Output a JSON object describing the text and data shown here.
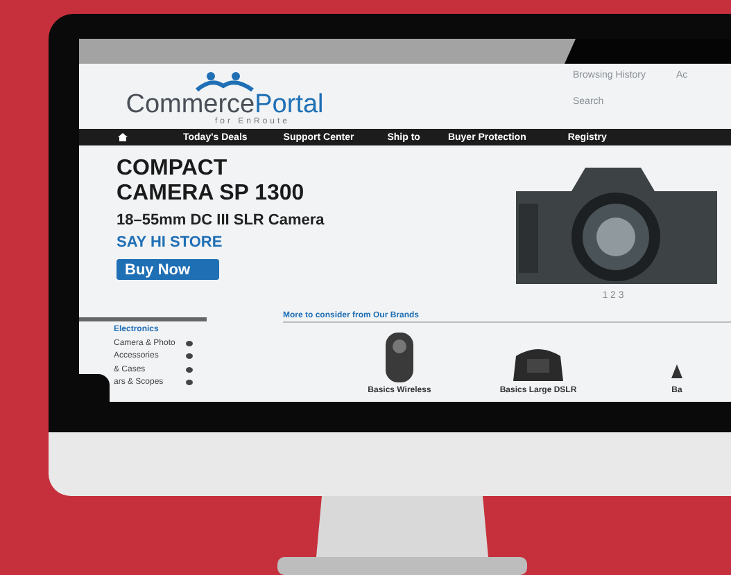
{
  "logo": {
    "name_first": "Commerce",
    "name_second": "Portal",
    "tagline": "for EnRoute"
  },
  "header_links": [
    {
      "label": "Browsing History"
    },
    {
      "label": "Ac"
    }
  ],
  "search": {
    "label": "Search"
  },
  "nav": [
    {
      "label": "Today's Deals"
    },
    {
      "label": "Support Center"
    },
    {
      "label": "Ship to"
    },
    {
      "label": "Buyer Protection"
    },
    {
      "label": "Registry"
    }
  ],
  "hero": {
    "title_lines": [
      "COMPACT",
      "CAMERA SP 1300"
    ],
    "subtitle": "18–55mm DC III SLR Camera",
    "store": "SAY HI STORE",
    "button": "Buy Now",
    "pager": "1 2 3"
  },
  "sidebar": {
    "heading": "Electronics",
    "items": [
      {
        "label": "Camera & Photo"
      },
      {
        "label": "Accessories"
      },
      {
        "label": "& Cases"
      },
      {
        "label": "ars & Scopes"
      }
    ]
  },
  "brands": {
    "title": "More to consider from Our Brands",
    "products": [
      {
        "kind": "remote",
        "name": "Basics Wireless"
      },
      {
        "kind": "bag",
        "name": "Basics Large DSLR"
      },
      {
        "kind": "partial",
        "name": "Ba"
      }
    ]
  }
}
